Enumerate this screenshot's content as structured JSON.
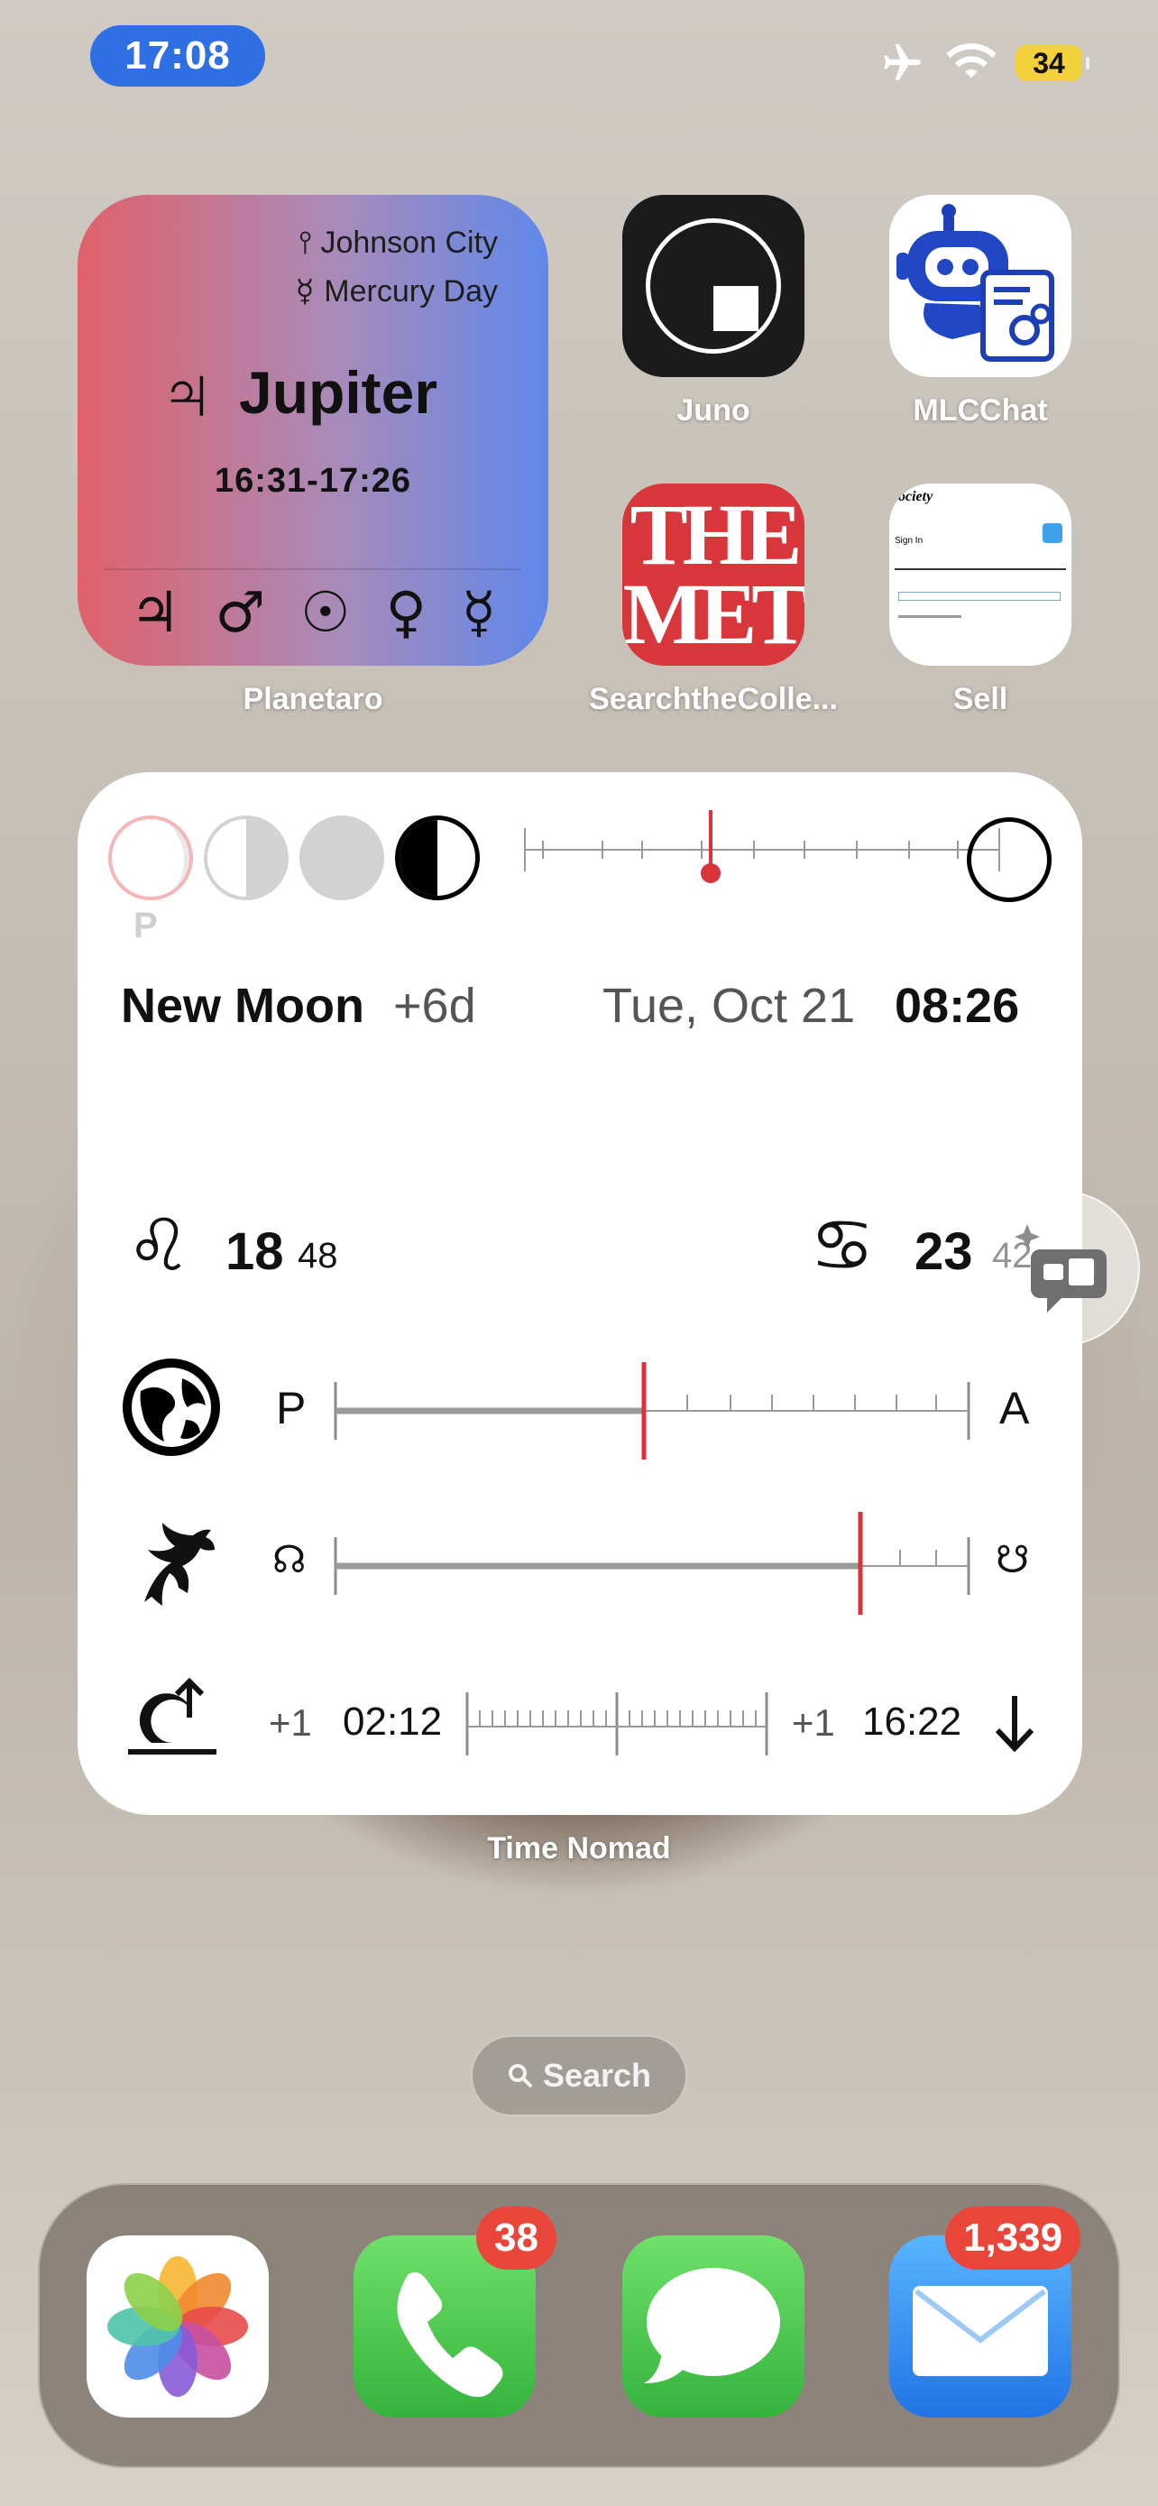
{
  "status": {
    "time": "17:08",
    "battery": "34"
  },
  "planetaro": {
    "location": "Johnson City",
    "day": "Mercury Day",
    "planet_symbol": "♃",
    "planet": "Jupiter",
    "hours": "16:31-17:26",
    "symbols": [
      "♃",
      "♂",
      "☉",
      "♀",
      "☿"
    ],
    "label": "Planetaro"
  },
  "apps": {
    "juno": "Juno",
    "mlc": "MLCChat",
    "met": "SearchtheColle...",
    "met_logo_top": "THE",
    "met_logo_bottom": "MET",
    "sell": "Sell",
    "sell_thumb_title": "ociety",
    "sell_thumb_signin": "Sign In"
  },
  "nomad": {
    "phase_letter": "P",
    "next_phase": "New Moon",
    "next_phase_offset": "+6d",
    "date": "Tue, Oct 21",
    "time": "08:26",
    "moon_sign_symbol": "♌",
    "moon_deg": "18",
    "moon_min": "48",
    "sun_sign_symbol": "♋",
    "sun_deg": "23",
    "sun_min": "42",
    "perigee": "P",
    "apogee": "A",
    "node_north": "☊",
    "node_south": "☋",
    "rise_day": "+1",
    "rise_time": "02:12",
    "set_day": "+1",
    "set_time": "16:22",
    "label": "Time Nomad"
  },
  "search": "Search",
  "dock": {
    "phone_badge": "38",
    "mail_badge": "1,339"
  }
}
